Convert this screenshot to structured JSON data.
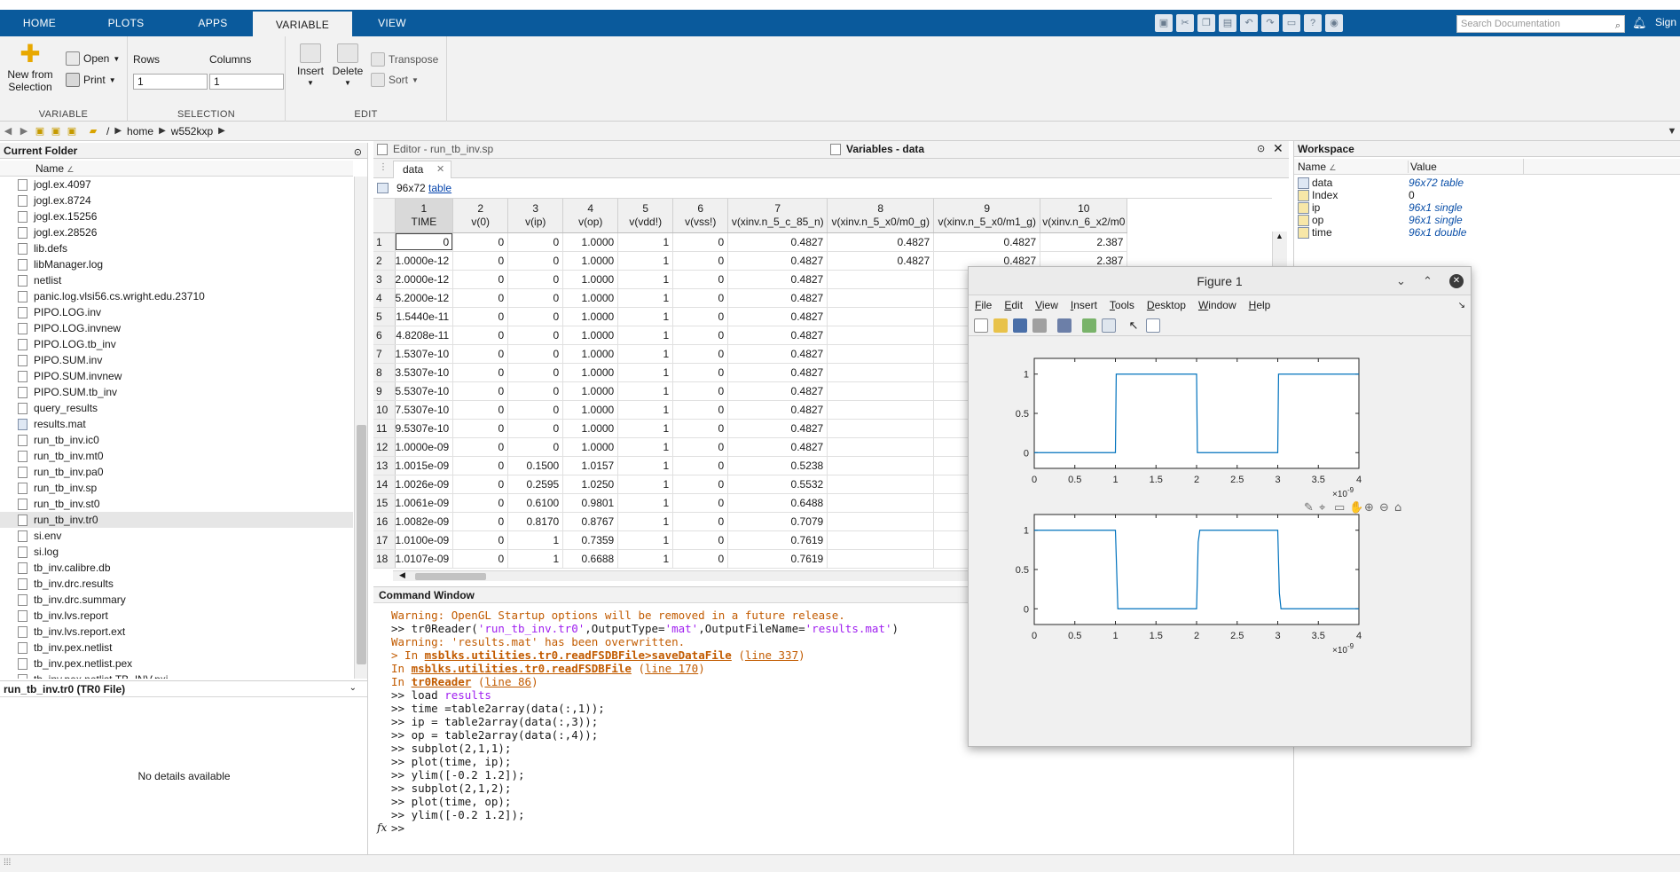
{
  "ribbon_tabs": [
    "HOME",
    "PLOTS",
    "APPS",
    "VARIABLE",
    "VIEW"
  ],
  "active_tab": "VARIABLE",
  "search": {
    "placeholder": "Search Documentation"
  },
  "signin": "Sign",
  "ribbon": {
    "new_from_selection": "New from\nSelection",
    "open": "Open",
    "print": "Print",
    "rows_label": "Rows",
    "columns_label": "Columns",
    "rows_value": "1",
    "columns_value": "1",
    "insert": "Insert",
    "delete": "Delete",
    "transpose": "Transpose",
    "sort": "Sort",
    "group_variable": "VARIABLE",
    "group_selection": "SELECTION",
    "group_edit": "EDIT"
  },
  "breadcrumb": [
    "/",
    "home",
    "w552kxp"
  ],
  "current_folder": {
    "title": "Current Folder",
    "name_header": "Name",
    "files": [
      "jogl.ex.4097",
      "jogl.ex.8724",
      "jogl.ex.15256",
      "jogl.ex.28526",
      "lib.defs",
      "libManager.log",
      "netlist",
      "panic.log.vlsi56.cs.wright.edu.23710",
      "PIPO.LOG.inv",
      "PIPO.LOG.invnew",
      "PIPO.LOG.tb_inv",
      "PIPO.SUM.inv",
      "PIPO.SUM.invnew",
      "PIPO.SUM.tb_inv",
      "query_results",
      "results.mat",
      "run_tb_inv.ic0",
      "run_tb_inv.mt0",
      "run_tb_inv.pa0",
      "run_tb_inv.sp",
      "run_tb_inv.st0",
      "run_tb_inv.tr0",
      "si.env",
      "si.log",
      "tb_inv.calibre.db",
      "tb_inv.drc.results",
      "tb_inv.drc.summary",
      "tb_inv.lvs.report",
      "tb_inv.lvs.report.ext",
      "tb_inv.pex.netlist",
      "tb_inv.pex.netlist.pex",
      "tb_inv.pex.netlist.TB_INV.pxi"
    ],
    "selected": "run_tb_inv.tr0"
  },
  "details": {
    "title": "run_tb_inv.tr0  (TR0 File)",
    "empty": "No details available"
  },
  "editor_title": "Editor - run_tb_inv.sp",
  "variables_title": "Variables - data",
  "variable_tab": "data",
  "var_size": "96x72",
  "var_type_link": "table",
  "table": {
    "col_numbers": [
      "1",
      "2",
      "3",
      "4",
      "5",
      "6",
      "7",
      "8",
      "9",
      "10"
    ],
    "col_names": [
      "TIME",
      "v(0)",
      "v(ip)",
      "v(op)",
      "v(vdd!)",
      "v(vss!)",
      "v(xinv.n_5_c_85_n)",
      "v(xinv.n_5_x0/m0_g)",
      "v(xinv.n_5_x0/m1_g)",
      "v(xinv.n_6_x2/m0"
    ],
    "rows": [
      [
        "0",
        "0",
        "0",
        "1.0000",
        "1",
        "0",
        "0.4827",
        "0.4827",
        "0.4827",
        "2.387"
      ],
      [
        "1.0000e-12",
        "0",
        "0",
        "1.0000",
        "1",
        "0",
        "0.4827",
        "0.4827",
        "0.4827",
        "2.387"
      ],
      [
        "2.0000e-12",
        "0",
        "0",
        "1.0000",
        "1",
        "0",
        "0.4827",
        "",
        "",
        ""
      ],
      [
        "5.2000e-12",
        "0",
        "0",
        "1.0000",
        "1",
        "0",
        "0.4827",
        "",
        "",
        ""
      ],
      [
        "1.5440e-11",
        "0",
        "0",
        "1.0000",
        "1",
        "0",
        "0.4827",
        "",
        "",
        ""
      ],
      [
        "4.8208e-11",
        "0",
        "0",
        "1.0000",
        "1",
        "0",
        "0.4827",
        "",
        "",
        ""
      ],
      [
        "1.5307e-10",
        "0",
        "0",
        "1.0000",
        "1",
        "0",
        "0.4827",
        "",
        "",
        ""
      ],
      [
        "3.5307e-10",
        "0",
        "0",
        "1.0000",
        "1",
        "0",
        "0.4827",
        "",
        "",
        ""
      ],
      [
        "5.5307e-10",
        "0",
        "0",
        "1.0000",
        "1",
        "0",
        "0.4827",
        "",
        "",
        ""
      ],
      [
        "7.5307e-10",
        "0",
        "0",
        "1.0000",
        "1",
        "0",
        "0.4827",
        "",
        "",
        ""
      ],
      [
        "9.5307e-10",
        "0",
        "0",
        "1.0000",
        "1",
        "0",
        "0.4827",
        "",
        "",
        ""
      ],
      [
        "1.0000e-09",
        "0",
        "0",
        "1.0000",
        "1",
        "0",
        "0.4827",
        "",
        "",
        ""
      ],
      [
        "1.0015e-09",
        "0",
        "0.1500",
        "1.0157",
        "1",
        "0",
        "0.5238",
        "",
        "",
        ""
      ],
      [
        "1.0026e-09",
        "0",
        "0.2595",
        "1.0250",
        "1",
        "0",
        "0.5532",
        "",
        "",
        ""
      ],
      [
        "1.0061e-09",
        "0",
        "0.6100",
        "0.9801",
        "1",
        "0",
        "0.6488",
        "",
        "",
        ""
      ],
      [
        "1.0082e-09",
        "0",
        "0.8170",
        "0.8767",
        "1",
        "0",
        "0.7079",
        "",
        "",
        ""
      ],
      [
        "1.0100e-09",
        "0",
        "1",
        "0.7359",
        "1",
        "0",
        "0.7619",
        "",
        "",
        ""
      ],
      [
        "1.0107e-09",
        "0",
        "1",
        "0.6688",
        "1",
        "0",
        "0.7619",
        "",
        "",
        ""
      ]
    ]
  },
  "command_window": {
    "title": "Command Window",
    "lines": [
      [
        {
          "t": "Warning: OpenGL Startup options will be removed in a future release.",
          "c": "warn"
        }
      ],
      [
        {
          "t": ">> tr0Reader(",
          "c": ""
        },
        {
          "t": "'run_tb_inv.tr0'",
          "c": "str"
        },
        {
          "t": ",OutputType=",
          "c": ""
        },
        {
          "t": "'mat'",
          "c": "str"
        },
        {
          "t": ",OutputFileName=",
          "c": ""
        },
        {
          "t": "'results.mat'",
          "c": "str"
        },
        {
          "t": ")",
          "c": ""
        }
      ],
      [
        {
          "t": "Warning: 'results.mat' has been overwritten.",
          "c": "warn"
        }
      ],
      [
        {
          "t": "> In ",
          "c": "warn"
        },
        {
          "t": "msblks.utilities.tr0.readFSDBFile>saveDataFile",
          "c": "warnbold"
        },
        {
          "t": " (",
          "c": "warn"
        },
        {
          "t": "line 337",
          "c": "warnlink"
        },
        {
          "t": ")",
          "c": "warn"
        }
      ],
      [
        {
          "t": "In ",
          "c": "warn"
        },
        {
          "t": "msblks.utilities.tr0.readFSDBFile",
          "c": "warnbold"
        },
        {
          "t": " (",
          "c": "warn"
        },
        {
          "t": "line 170",
          "c": "warnlink"
        },
        {
          "t": ")",
          "c": "warn"
        }
      ],
      [
        {
          "t": "In ",
          "c": "warn"
        },
        {
          "t": "tr0Reader",
          "c": "warnbold"
        },
        {
          "t": " (",
          "c": "warn"
        },
        {
          "t": "line 86",
          "c": "warnlink"
        },
        {
          "t": ")",
          "c": "warn"
        }
      ],
      [
        {
          "t": ">> load ",
          "c": ""
        },
        {
          "t": "results",
          "c": "str"
        }
      ],
      [
        {
          "t": ">> time =table2array(data(:,1));",
          "c": ""
        }
      ],
      [
        {
          "t": ">> ip = table2array(data(:,3));",
          "c": ""
        }
      ],
      [
        {
          "t": ">> op = table2array(data(:,4));",
          "c": ""
        }
      ],
      [
        {
          "t": ">> subplot(2,1,1);",
          "c": ""
        }
      ],
      [
        {
          "t": ">> plot(time, ip);",
          "c": ""
        }
      ],
      [
        {
          "t": ">> ylim([-0.2 1.2]);",
          "c": ""
        }
      ],
      [
        {
          "t": ">> subplot(2,1,2);",
          "c": ""
        }
      ],
      [
        {
          "t": ">> plot(time, op);",
          "c": ""
        }
      ],
      [
        {
          "t": ">> ylim([-0.2 1.2]);",
          "c": ""
        }
      ],
      [
        {
          "t": ">>",
          "c": ""
        }
      ]
    ],
    "fx": "fx"
  },
  "workspace": {
    "title": "Workspace",
    "name_header": "Name",
    "value_header": "Value",
    "vars": [
      {
        "name": "data",
        "value": "96x72 table",
        "italic": true
      },
      {
        "name": "Index",
        "value": "0",
        "italic": false
      },
      {
        "name": "ip",
        "value": "96x1 single",
        "italic": true
      },
      {
        "name": "op",
        "value": "96x1 single",
        "italic": true
      },
      {
        "name": "time",
        "value": "96x1 double",
        "italic": true
      }
    ]
  },
  "figure": {
    "title": "Figure 1",
    "menu": [
      "File",
      "Edit",
      "View",
      "Insert",
      "Tools",
      "Desktop",
      "Window",
      "Help"
    ],
    "x_exponent": "×10",
    "x_exponent_power": "-9"
  },
  "chart_data": [
    {
      "type": "line",
      "xlim": [
        0,
        4
      ],
      "ylim": [
        -0.2,
        1.2
      ],
      "x_ticks": [
        "0",
        "0.5",
        "1",
        "1.5",
        "2",
        "2.5",
        "3",
        "3.5",
        "4"
      ],
      "y_ticks": [
        "0",
        "0.5",
        "1"
      ],
      "x_scale_label": "×10^-9",
      "color": "#0072bd",
      "series": [
        {
          "x": [
            0,
            1.0,
            1.01,
            2.0,
            2.01,
            3.0,
            3.01,
            4.0
          ],
          "y": [
            0,
            0,
            1,
            1,
            0,
            0,
            1,
            1
          ]
        }
      ]
    },
    {
      "type": "line",
      "xlim": [
        0,
        4
      ],
      "ylim": [
        -0.2,
        1.2
      ],
      "x_ticks": [
        "0",
        "0.5",
        "1",
        "1.5",
        "2",
        "2.5",
        "3",
        "3.5",
        "4"
      ],
      "y_ticks": [
        "0",
        "0.5",
        "1"
      ],
      "x_scale_label": "×10^-9",
      "color": "#0072bd",
      "series": [
        {
          "x": [
            0,
            1.0,
            1.01,
            1.03,
            2.0,
            2.02,
            2.04,
            3.0,
            3.02,
            3.04,
            4.0
          ],
          "y": [
            1,
            1,
            0.67,
            0,
            0,
            0.85,
            1,
            1,
            0.2,
            0,
            0
          ]
        }
      ]
    }
  ]
}
